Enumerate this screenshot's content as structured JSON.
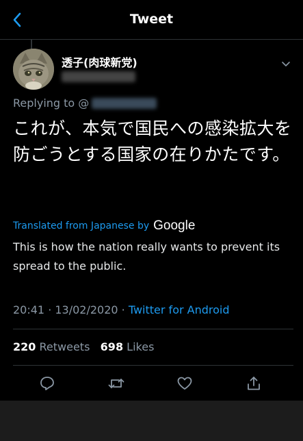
{
  "header": {
    "title": "Tweet"
  },
  "author": {
    "display_name": "透子(肉球新党)"
  },
  "reply": {
    "prefix": "Replying to @"
  },
  "tweet": {
    "text": "これが、本気で国民への感染拡大を防ごうとする国家の在りかたです。"
  },
  "translation": {
    "label": "Translated from Japanese by",
    "provider": "Google",
    "text": "This is how the nation really wants to prevent its spread to the public."
  },
  "meta": {
    "time_date": "20:41 · 13/02/2020 · ",
    "source": "Twitter for Android"
  },
  "stats": {
    "retweets_count": "220",
    "retweets_label": "Retweets",
    "likes_count": "698",
    "likes_label": "Likes"
  },
  "colors": {
    "accent": "#1d9bf0",
    "muted": "#8b98a5",
    "background": "#000000"
  }
}
